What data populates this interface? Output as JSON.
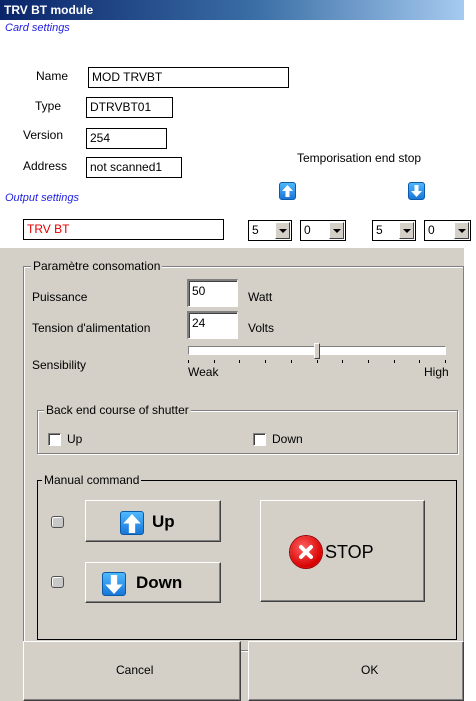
{
  "window": {
    "title": "TRV BT module"
  },
  "card_settings": {
    "heading": "Card settings",
    "name_label": "Name",
    "name_value": "MOD TRVBT",
    "type_label": "Type",
    "type_value": "DTRVBT01",
    "version_label": "Version",
    "version_value": "254",
    "address_label": "Address",
    "address_value": "not scanned1"
  },
  "temporisation": {
    "label": "Temporisation end stop",
    "up_icon": "arrow-up-icon",
    "down_icon": "arrow-down-icon",
    "up_select_1": "5",
    "up_select_2": "0",
    "down_select_1": "5",
    "down_select_2": "0"
  },
  "output_settings": {
    "heading": "Output settings",
    "output_name": "TRV BT",
    "output_color": "#e00000"
  },
  "consumption": {
    "group_title": "Paramètre consomation",
    "power_label": "Puissance",
    "power_value": "50",
    "power_unit": "Watt",
    "voltage_label": "Tension d'alimentation",
    "voltage_value": "24",
    "voltage_unit": "Volts",
    "sensibility_label": "Sensibility",
    "sensibility_min_label": "Weak",
    "sensibility_max_label": "High",
    "sensibility_level": 0.5
  },
  "back_end": {
    "group_title": "Back end course of shutter",
    "up_label": "Up",
    "down_label": "Down"
  },
  "manual": {
    "group_title": "Manual command",
    "up_label": "Up",
    "down_label": "Down",
    "stop_label": "STOP"
  },
  "footer": {
    "cancel_label": "Cancel",
    "ok_label": "OK"
  }
}
